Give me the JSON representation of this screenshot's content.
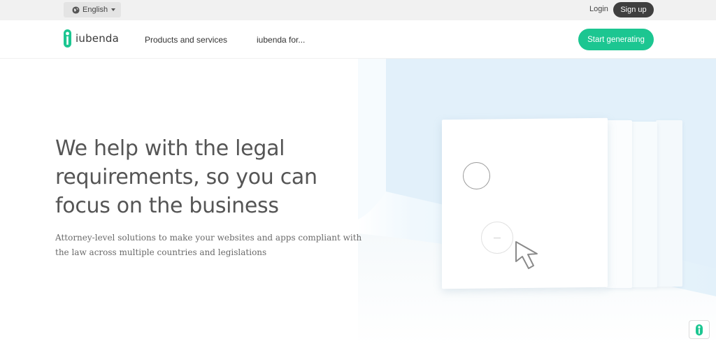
{
  "topbar": {
    "language": {
      "label": "English",
      "icon": "globe-icon"
    },
    "login_label": "Login",
    "signup_label": "Sign up"
  },
  "nav": {
    "logo_text": "iubenda",
    "items": [
      {
        "label": "Products and services"
      },
      {
        "label": "iubenda for..."
      }
    ],
    "cta_label": "Start generating"
  },
  "hero": {
    "title": "We help with the legal requirements, so you can focus on the business",
    "subtitle": "Attorney-level solutions to make your websites and apps compliant with the law across multiple countries and legislations"
  },
  "floating_button": {
    "icon": "iubenda-badge-icon"
  },
  "colors": {
    "brand_green": "#1cc691",
    "signup_bg": "#3f3f3f",
    "topbar_bg": "#f1f1f1",
    "hero_blue": "#e6f3fb"
  }
}
